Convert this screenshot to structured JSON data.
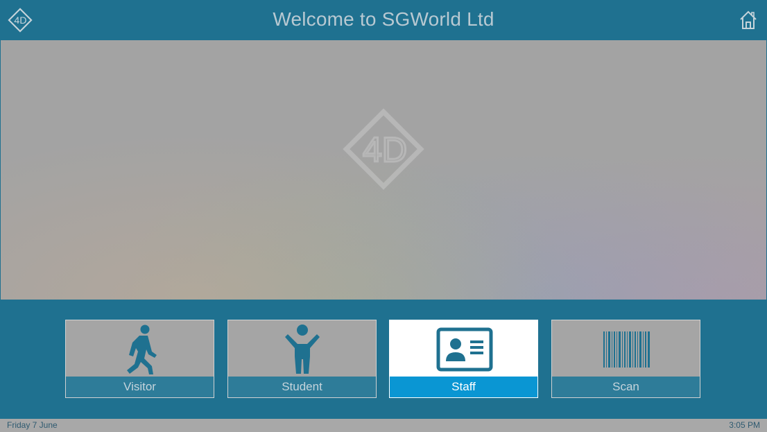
{
  "header": {
    "title": "Welcome to SGWorld Ltd",
    "logo_text": "4D",
    "home_icon": "home-icon"
  },
  "hero": {
    "watermark_text": "4D"
  },
  "tiles": [
    {
      "label": "Visitor",
      "icon": "walking-person-icon",
      "active": false
    },
    {
      "label": "Student",
      "icon": "person-arms-up-icon",
      "active": false
    },
    {
      "label": "Staff",
      "icon": "id-card-icon",
      "active": true
    },
    {
      "label": "Scan",
      "icon": "barcode-icon",
      "active": false
    }
  ],
  "footer": {
    "date": "Friday 7 June",
    "time": "3:05 PM"
  },
  "colors": {
    "primary": "#1f7190",
    "accent": "#0a96d3",
    "tile_inactive": "#a5a5a5"
  }
}
